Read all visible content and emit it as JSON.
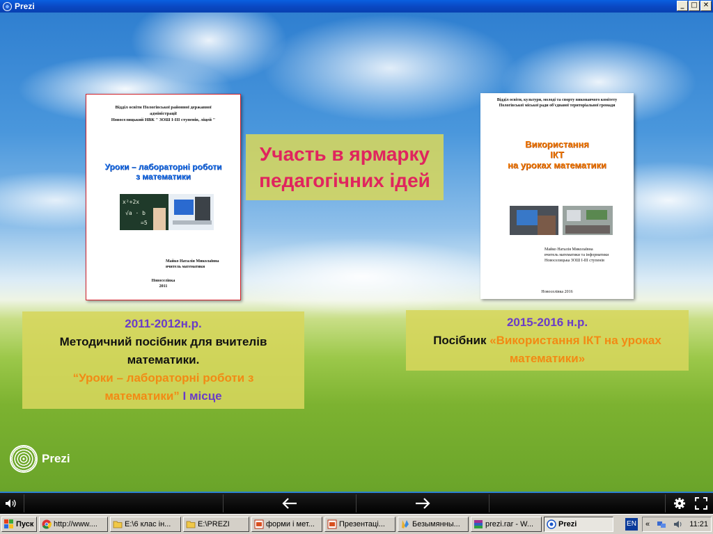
{
  "window": {
    "title": "Prezi",
    "buttons": [
      "_",
      "□",
      "✕"
    ]
  },
  "center_title": {
    "line1": "Участь в ярмарку",
    "line2": "педагогічних ідей"
  },
  "cover_left": {
    "org_line1": "Відділ освіти Пологівської районної державної",
    "org_line2": "адміністрації",
    "org_line3": "Новоселицький НВК \" ЗОШ І-ІІІ ступенів, ліцей \"",
    "title_line1": "Уроки – лабораторні роботи",
    "title_line2": "з математики",
    "author_line1": "Майко Наталія Миколаївна",
    "author_line2": "вчитель математики",
    "city": "Новоселівка",
    "year": "2011"
  },
  "cover_right": {
    "org_line1": "Відділ освіти, культури, молоді та спорту виконавчого комітету",
    "org_line2": "Пологівської міської ради об'єднаної територіальної громади",
    "title_line1": "Використання",
    "title_line2": "ІКТ",
    "title_line3": "на уроках математики",
    "author_line1": "Майко Наталія Миколаївна",
    "author_line2": "вчитель математики та інформатики",
    "author_line3": "Новоселицька ЗОШ І-ІІІ ступенів",
    "city_year": "Новоселівка 2016"
  },
  "info_left": {
    "years": "2011-2012н.р.",
    "desc_line1": "Методичний посібник для вчителів",
    "desc_line2": "математики.",
    "quote_line1": "“Уроки – лабораторні роботи з",
    "quote_line2": "математики”",
    "place": " І місце"
  },
  "info_right": {
    "years": "2015-2016 н.р.",
    "label": "Посібник ",
    "quote_line1": " «Використання ІКТ на уроках",
    "quote_line2": "математики»"
  },
  "logo_text": "Prezi",
  "player": {
    "prev_icon": "arrow-left-icon",
    "next_icon": "arrow-right-icon"
  },
  "taskbar": {
    "start": "Пуск",
    "tasks": [
      {
        "label": "http://www....",
        "icon": "chrome-icon"
      },
      {
        "label": "E:\\6 клас ін...",
        "icon": "folder-icon"
      },
      {
        "label": "E:\\PREZI",
        "icon": "folder-icon"
      },
      {
        "label": "форми і мет...",
        "icon": "ppt-icon"
      },
      {
        "label": "Презентаці...",
        "icon": "ppt-icon"
      },
      {
        "label": "Безымянны...",
        "icon": "paint-icon"
      },
      {
        "label": "prezi.rar - W...",
        "icon": "winrar-icon"
      },
      {
        "label": "Prezi",
        "icon": "prezi-icon"
      }
    ],
    "lang": "EN",
    "chevron": "«",
    "clock": "11:21"
  }
}
